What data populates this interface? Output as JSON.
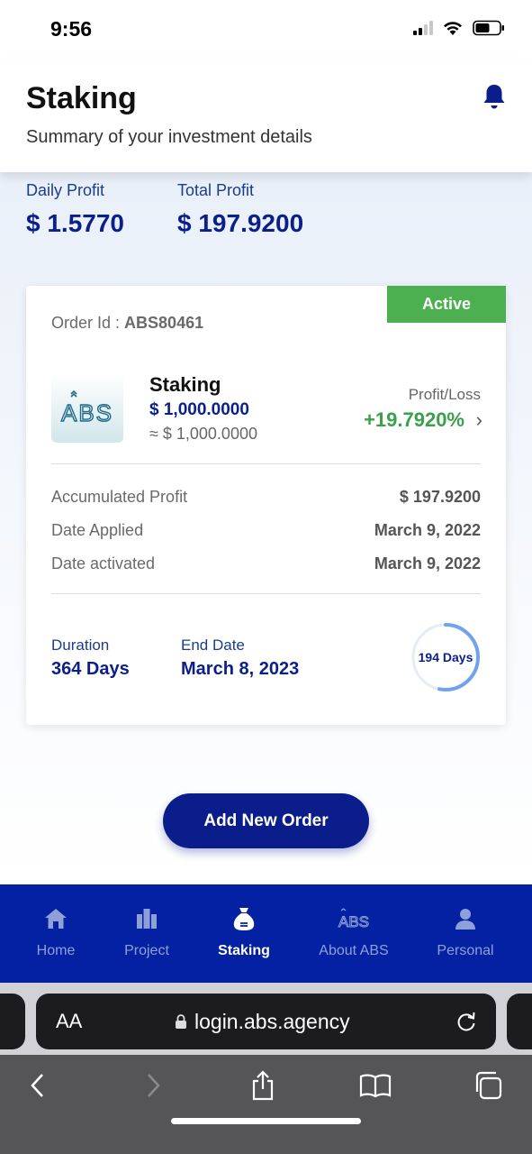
{
  "status_bar": {
    "time": "9:56"
  },
  "header": {
    "title": "Staking",
    "subtitle": "Summary of your investment details"
  },
  "summary": {
    "daily_profit_label": "Daily Profit",
    "daily_profit_value": "$ 1.5770",
    "total_profit_label": "Total Profit",
    "total_profit_value": "$ 197.9200"
  },
  "order": {
    "status_badge": "Active",
    "order_id_label": "Order Id :",
    "order_id": "ABS80461",
    "logo_text": "ABS",
    "product_name": "Staking",
    "amount": "$ 1,000.0000",
    "approx_amount": "≈ $ 1,000.0000",
    "profit_loss_label": "Profit/Loss",
    "profit_loss_value": "+19.7920%",
    "details": [
      {
        "label": "Accumulated Profit",
        "value": "$ 197.9200"
      },
      {
        "label": "Date Applied",
        "value": "March 9, 2022"
      },
      {
        "label": "Date activated",
        "value": "March 9, 2022"
      }
    ],
    "duration_label": "Duration",
    "duration_value": "364 Days",
    "end_date_label": "End Date",
    "end_date_value": "March 8, 2023",
    "days_remaining": "194 Days",
    "days_progress_fraction": 0.53
  },
  "actions": {
    "add_order_label": "Add New Order"
  },
  "bottom_nav": {
    "items": [
      {
        "label": "Home",
        "icon": "home-icon",
        "active": false
      },
      {
        "label": "Project",
        "icon": "building-icon",
        "active": false
      },
      {
        "label": "Staking",
        "icon": "money-bag-icon",
        "active": true
      },
      {
        "label": "About ABS",
        "icon": "abs-logo-icon",
        "active": false
      },
      {
        "label": "Personal",
        "icon": "person-icon",
        "active": false
      }
    ]
  },
  "browser": {
    "text_size_label": "AA",
    "url": "login.abs.agency"
  },
  "colors": {
    "primary": "#0b1d8a",
    "nav_background": "#0521a3",
    "active_badge": "#4cb050",
    "profit_green": "#3aa14a"
  }
}
